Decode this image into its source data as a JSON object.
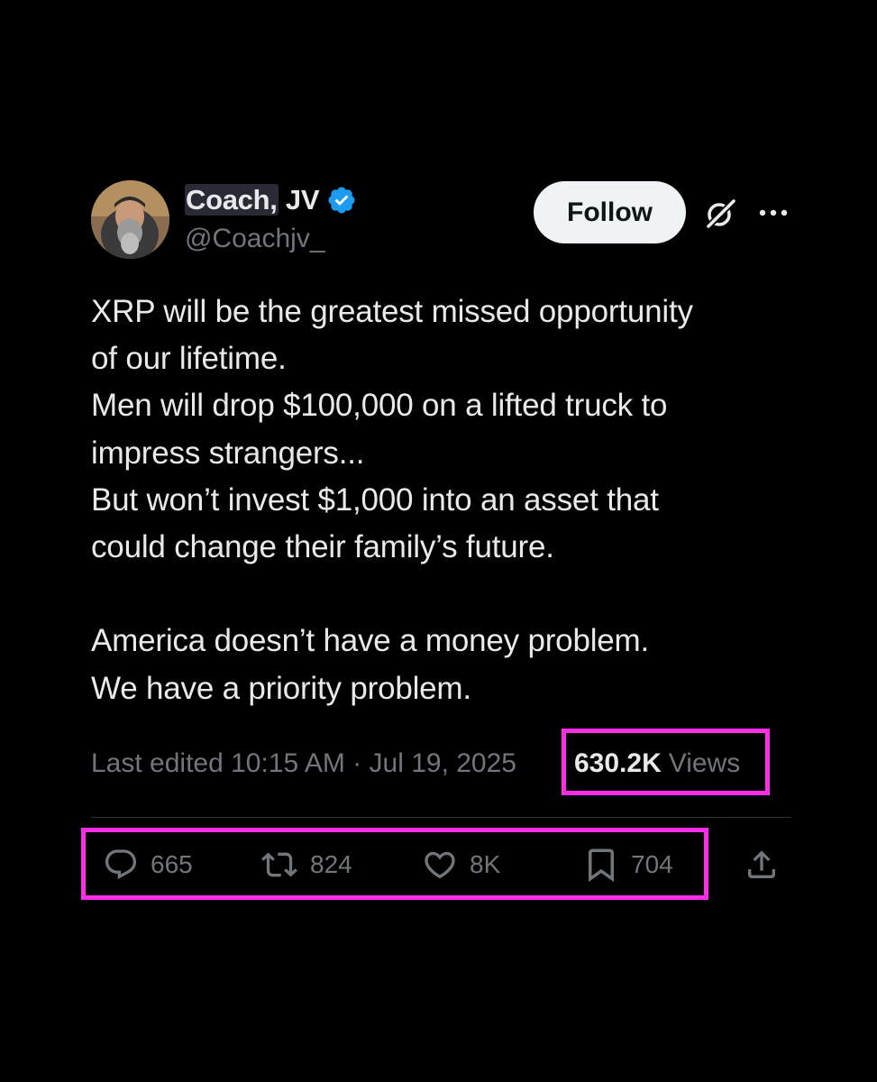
{
  "author": {
    "display_name_highlighted": "Coach,",
    "display_name_rest": " JV",
    "handle": "@Coachjv_",
    "verified": true
  },
  "header": {
    "follow_label": "Follow",
    "grok_icon": "grok-icon",
    "more_icon": "more-horizontal-icon"
  },
  "tweet": {
    "lines": [
      "XRP will be the greatest missed opportunity",
      "of our lifetime.",
      "Men will drop $100,000 on a lifted truck to",
      "impress strangers...",
      "But won’t invest $1,000 into an asset that",
      "could change their family’s future.",
      "",
      "America doesn’t have a money problem.",
      "We have a priority problem."
    ]
  },
  "meta": {
    "edited_text": "Last edited 10:15 AM · Jul 19, 2025",
    "views_count": "630.2K",
    "views_label": "Views"
  },
  "actions": {
    "replies": "665",
    "reposts": "824",
    "likes": "8K",
    "bookmarks": "704"
  },
  "colors": {
    "background": "#000000",
    "text_primary": "#e7e9ea",
    "text_secondary": "#71767b",
    "verified_blue": "#1d9bf0",
    "highlight_box": "#ff2ee6",
    "follow_button_bg": "#eff3f4"
  }
}
